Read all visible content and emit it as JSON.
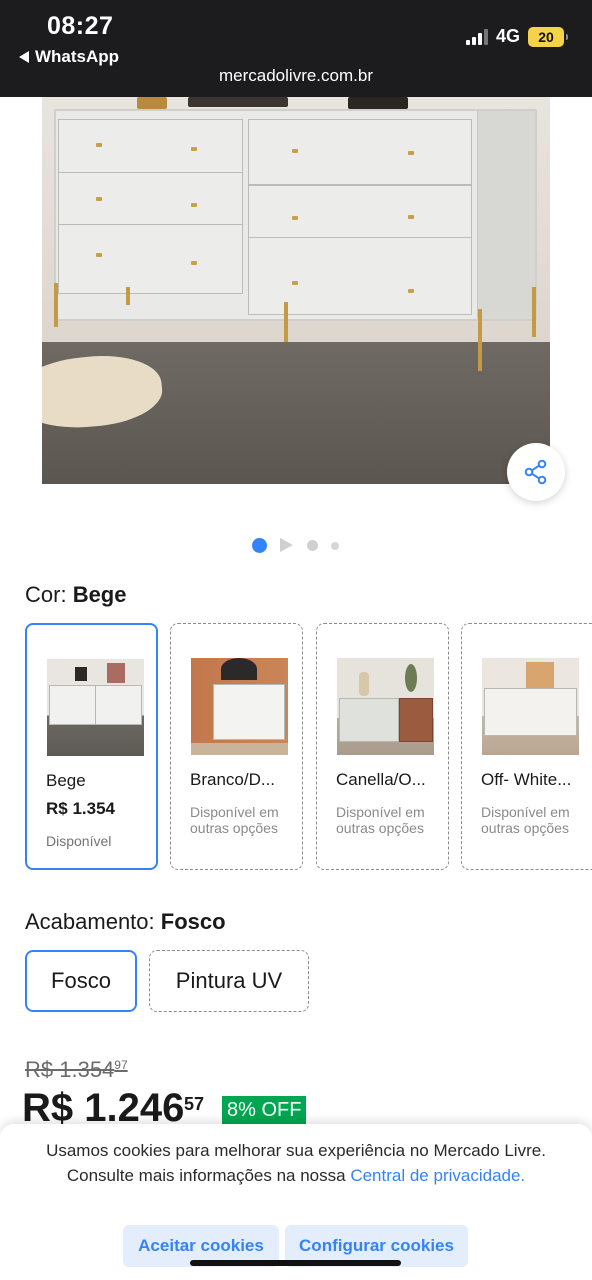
{
  "status_bar": {
    "time": "08:27",
    "back_app": "WhatsApp",
    "network": "4G",
    "battery": "20",
    "url": "mercadolivre.com.br"
  },
  "gallery": {
    "share_icon": "share-icon",
    "dot_count": 4,
    "active_index": 0
  },
  "color": {
    "label": "Cor: ",
    "value": "Bege",
    "options": [
      {
        "name": "Bege",
        "price": "R$ 1.354",
        "availability": "Disponível",
        "selected": true
      },
      {
        "name": "Branco/D...",
        "note": "Disponível em outras opções",
        "selected": false
      },
      {
        "name": "Canella/O...",
        "note": "Disponível em outras opções",
        "selected": false
      },
      {
        "name": "Off- White...",
        "note": "Disponível em outras opções",
        "selected": false
      }
    ]
  },
  "finish": {
    "label": "Acabamento: ",
    "value": "Fosco",
    "options": [
      "Fosco",
      "Pintura UV"
    ]
  },
  "pricing": {
    "old_price": "R$ 1.354",
    "old_cents": "97",
    "price": "R$ 1.246",
    "cents": "57",
    "discount": "8% OFF"
  },
  "cookie": {
    "text": "Usamos cookies para melhorar sua experiência no Mercado Livre. Consulte mais informações na nossa ",
    "link": "Central de privacidade.",
    "accept": "Aceitar cookies",
    "configure": "Configurar cookies"
  },
  "colors": {
    "accent": "#3483fa",
    "discount_green": "#00a650"
  }
}
